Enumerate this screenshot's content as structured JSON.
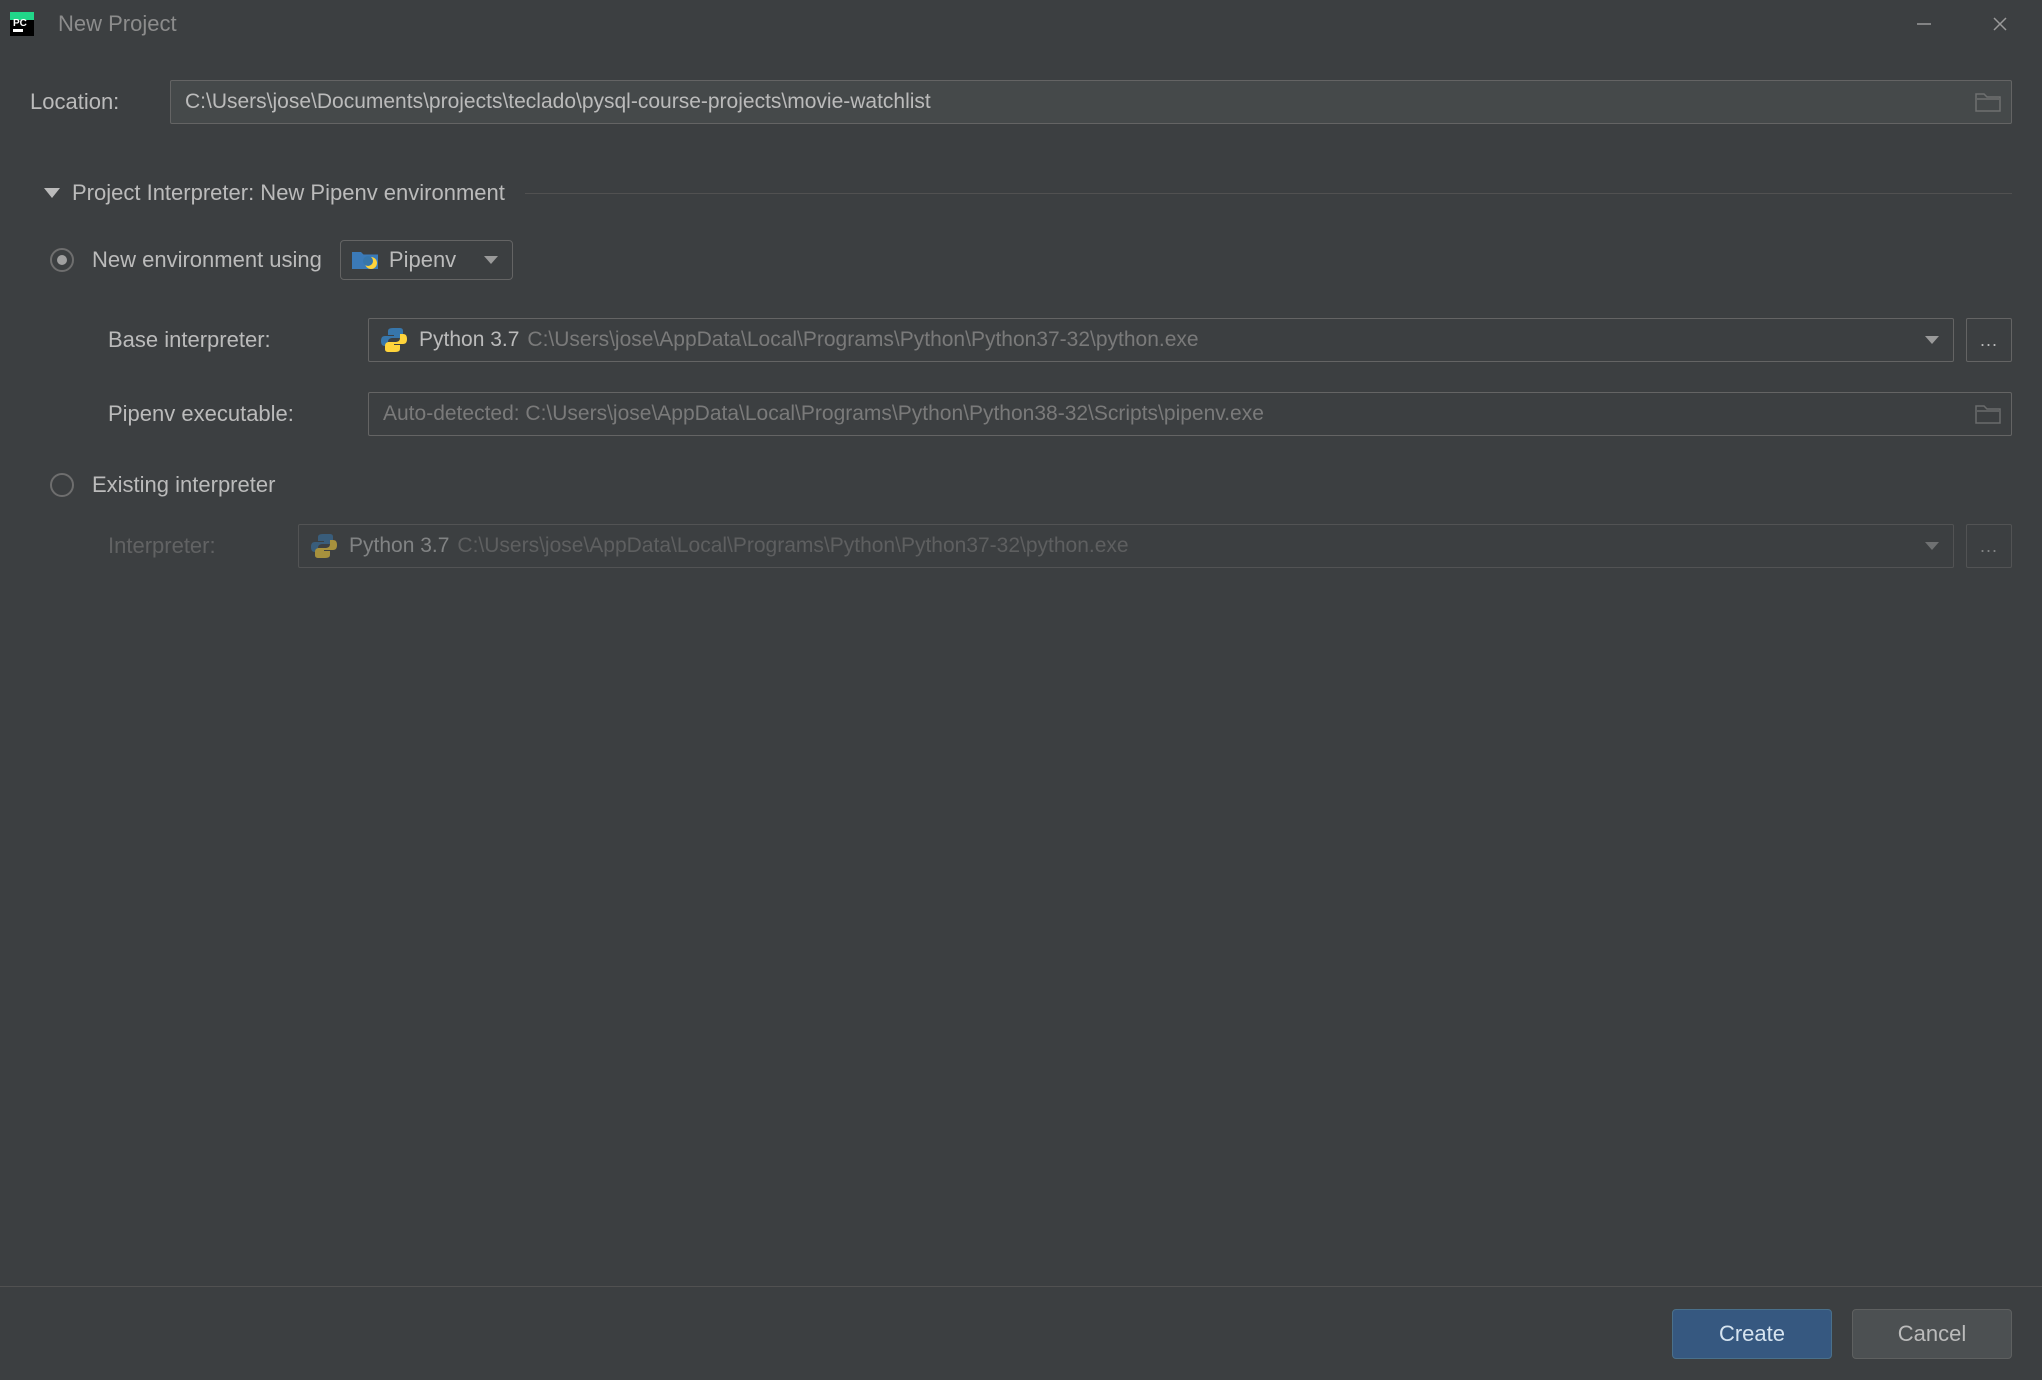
{
  "window": {
    "title": "New Project"
  },
  "location": {
    "label": "Location:",
    "value": "C:\\Users\\jose\\Documents\\projects\\teclado\\pysql-course-projects\\movie-watchlist"
  },
  "section": {
    "title": "Project Interpreter: New Pipenv environment"
  },
  "new_env": {
    "radio_label": "New environment using",
    "tool": "Pipenv",
    "base_interpreter_label": "Base interpreter:",
    "base_interpreter_name": "Python 3.7",
    "base_interpreter_path": "C:\\Users\\jose\\AppData\\Local\\Programs\\Python\\Python37-32\\python.exe",
    "pipenv_exec_label": "Pipenv executable:",
    "pipenv_exec_placeholder": "Auto-detected: C:\\Users\\jose\\AppData\\Local\\Programs\\Python\\Python38-32\\Scripts\\pipenv.exe"
  },
  "existing": {
    "radio_label": "Existing interpreter",
    "interpreter_label": "Interpreter:",
    "interpreter_name": "Python 3.7",
    "interpreter_path": "C:\\Users\\jose\\AppData\\Local\\Programs\\Python\\Python37-32\\python.exe"
  },
  "footer": {
    "create": "Create",
    "cancel": "Cancel"
  }
}
